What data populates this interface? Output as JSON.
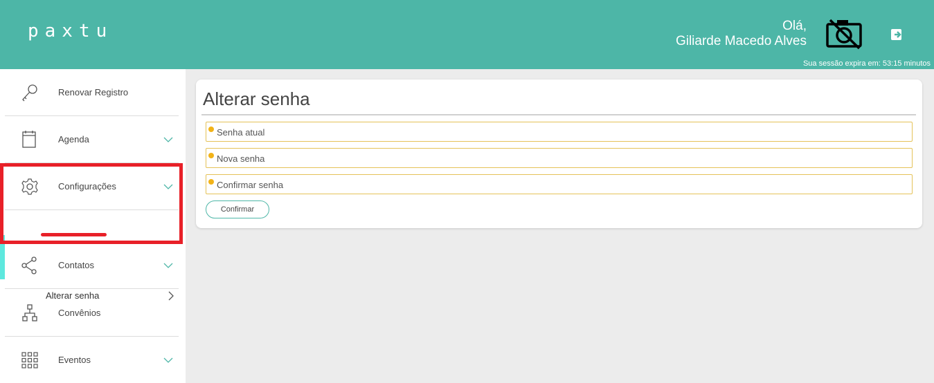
{
  "header": {
    "logo": "paxtu",
    "greeting": "Olá,",
    "user_name": "Giliarde Macedo Alves",
    "session_text": "Sua sessão expira em: 53:15 minutos",
    "avatar_icon": "camera-off-icon",
    "logout_icon": "logout-icon"
  },
  "sidebar": {
    "items": [
      {
        "label": "Renovar  Registro",
        "icon": "key-icon"
      },
      {
        "label": "Agenda",
        "icon": "calendar-icon"
      },
      {
        "label": "Configurações",
        "icon": "gear-icon",
        "active": true
      },
      {
        "label": "Contatos",
        "icon": "share-icon"
      },
      {
        "label": "Convênios",
        "icon": "org-chart-icon"
      },
      {
        "label": "Eventos",
        "icon": "grid-icon"
      }
    ],
    "sub_item": {
      "label": "Alterar senha"
    }
  },
  "form": {
    "title": "Alterar senha",
    "fields": [
      {
        "placeholder": "Senha atual",
        "value": ""
      },
      {
        "placeholder": "Nova senha",
        "value": ""
      },
      {
        "placeholder": "Confirmar senha",
        "value": ""
      }
    ],
    "submit_label": "Confirmar"
  },
  "colors": {
    "header_bg": "#4db6a7",
    "accent": "#5ee8de",
    "highlight_red": "#e82028",
    "field_border": "#e5c257"
  }
}
